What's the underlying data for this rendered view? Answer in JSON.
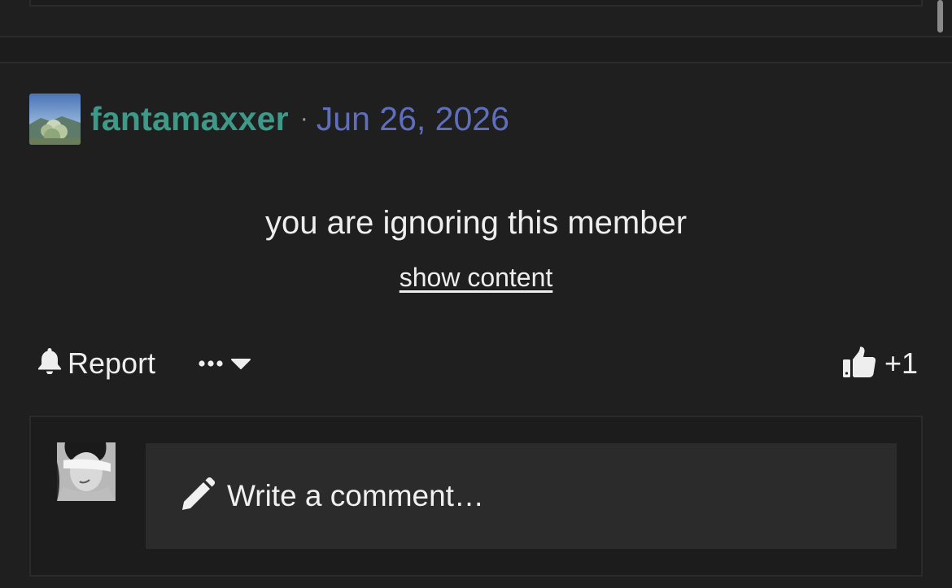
{
  "post": {
    "author": "fantamaxxer",
    "separator": "·",
    "date": "Jun 26, 2026",
    "ignored_message": "you are ignoring this member",
    "show_content_label": "show content"
  },
  "actions": {
    "report_label": "Report",
    "like_count": "+1"
  },
  "comment": {
    "placeholder": "Write a comment…"
  },
  "colors": {
    "background": "#1f1f1f",
    "author": "#3e9a88",
    "date": "#5f6fbd",
    "text": "#eeeeee",
    "input_bg": "#2b2b2b"
  },
  "icons": {
    "report": "bell-icon",
    "more": "ellipsis-icon",
    "dropdown": "caret-down-icon",
    "like": "thumbs-up-icon",
    "compose": "pencil-icon"
  }
}
